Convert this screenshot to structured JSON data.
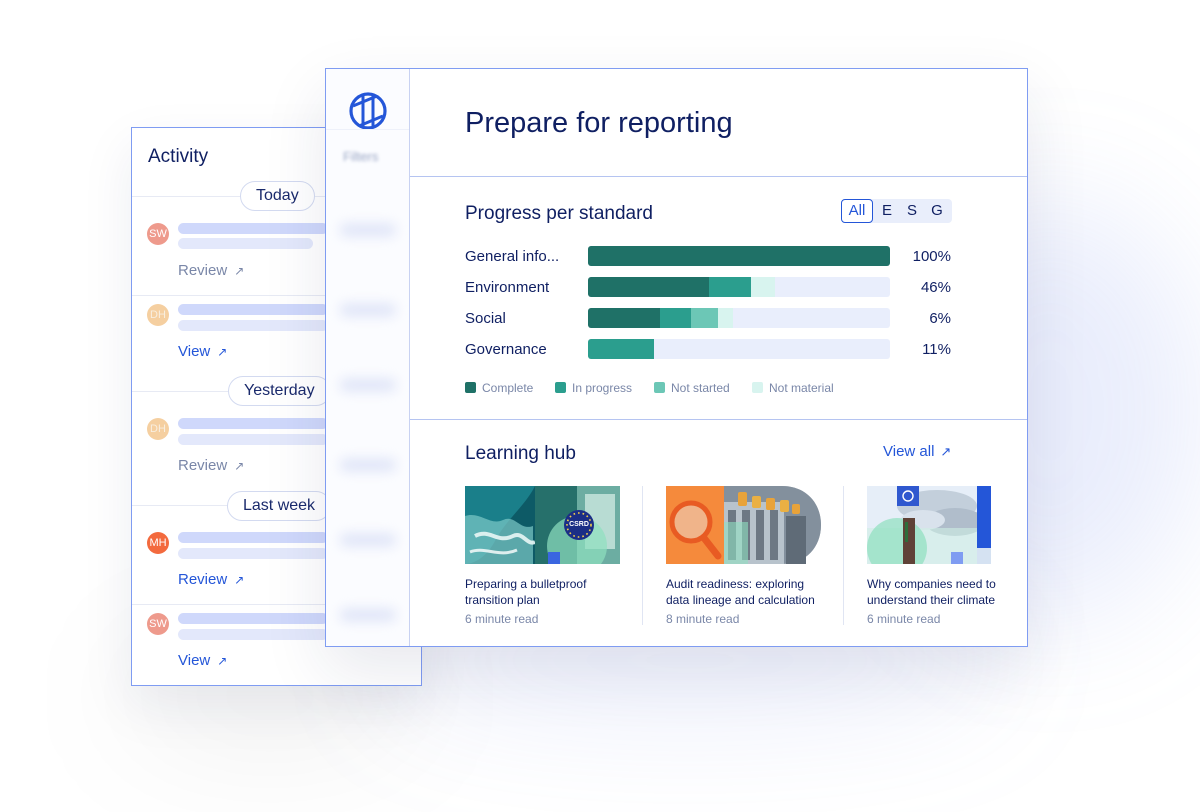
{
  "activity": {
    "title": "Activity",
    "groups": [
      "Today",
      "Yesterday",
      "Last week"
    ],
    "items": [
      {
        "initials": "SW",
        "action": "Review"
      },
      {
        "initials": "DH",
        "action": "View"
      },
      {
        "initials": "DH",
        "action": "Review"
      },
      {
        "initials": "MH",
        "action": "Review"
      },
      {
        "initials": "SW",
        "action": "View"
      }
    ]
  },
  "sidebar": {
    "filters_label": "Filters"
  },
  "header": {
    "title": "Prepare for reporting"
  },
  "progress": {
    "title": "Progress per standard",
    "tabs": [
      "All",
      "E",
      "S",
      "G"
    ],
    "active_tab": "All",
    "rows": [
      {
        "label": "General info...",
        "value": "100%",
        "complete": 1.0,
        "in_progress": 0,
        "not_started": 0,
        "not_material": 0
      },
      {
        "label": "Environment",
        "value": "46%",
        "complete": 0.4,
        "in_progress": 0.14,
        "not_started": 0,
        "not_material": 0.08
      },
      {
        "label": "Social",
        "value": "6%",
        "complete": 0.24,
        "in_progress": 0.1,
        "not_started": 0.09,
        "not_material": 0.05
      },
      {
        "label": "Governance",
        "value": "11%",
        "complete": 0,
        "in_progress": 0.22,
        "not_started": 0,
        "not_material": 0
      }
    ],
    "legend": [
      {
        "label": "Complete",
        "color": "#1f7167"
      },
      {
        "label": "In progress",
        "color": "#2b9e8e"
      },
      {
        "label": "Not started",
        "color": "#6cc7b6"
      },
      {
        "label": "Not material",
        "color": "#d8f4ef"
      }
    ]
  },
  "learning": {
    "title": "Learning hub",
    "view_all": "View all",
    "cards": [
      {
        "title": "Preparing a bulletproof transition plan",
        "meta": "6 minute read",
        "badge": "CSRD"
      },
      {
        "title": "Audit readiness: exploring data lineage and calculation",
        "meta": "8 minute read"
      },
      {
        "title": "Why companies need to understand their climate",
        "meta": "6 minute read"
      }
    ]
  },
  "colors": {
    "accent": "#2456d8",
    "navy": "#0f1f62",
    "complete": "#1f7167",
    "in_progress": "#2b9e8e",
    "not_started": "#6cc7b6",
    "not_material": "#d8f4ef",
    "track": "#e9eefc",
    "panel_border": "#7f9cf2"
  }
}
